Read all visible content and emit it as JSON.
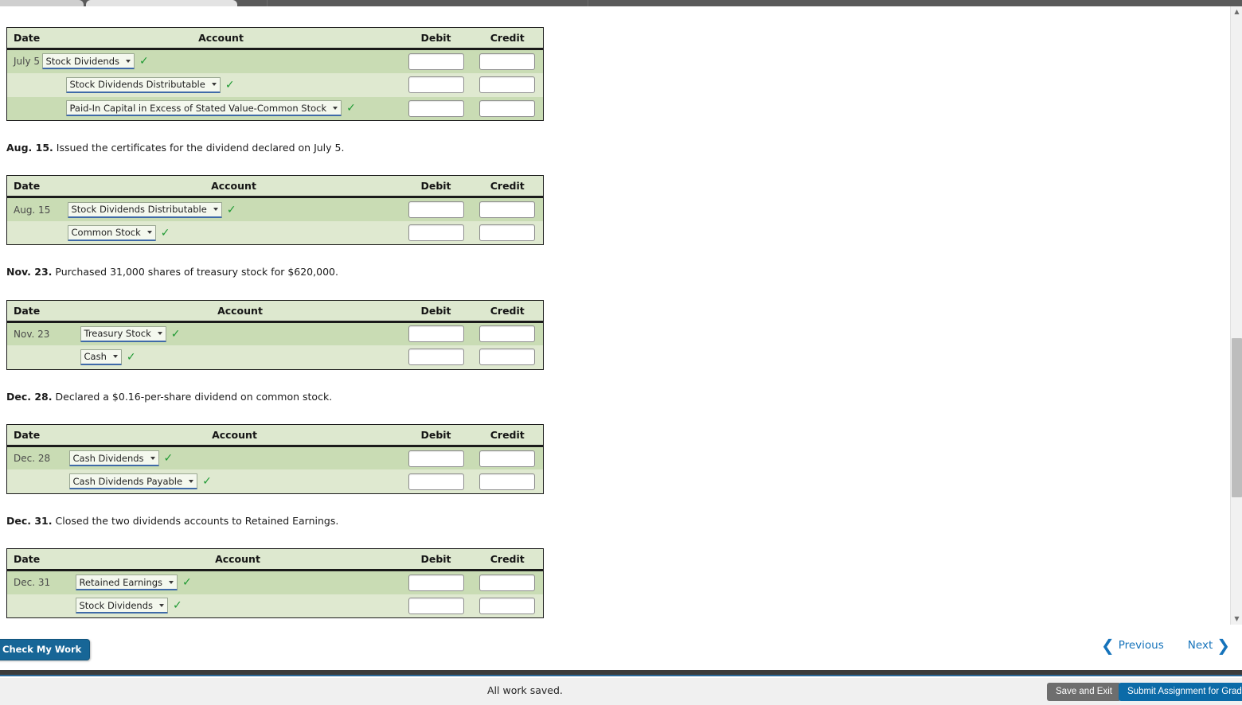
{
  "accent": {
    "blue": "#1573bb",
    "button_blue": "#176697",
    "submit_blue": "#0b6ba8",
    "check_green": "#1f9a33",
    "row_dark": "#c9dcb4",
    "row_light": "#dfe9d0",
    "header_green": "#dde8cf"
  },
  "columns": {
    "date": "Date",
    "account": "Account",
    "debit": "Debit",
    "credit": "Credit"
  },
  "icons": {
    "caret": "chevron-down-icon",
    "check": "check-mark-icon",
    "prev_chevron": "chevron-left-icon",
    "next_chevron": "chevron-right-icon",
    "scroll_up": "scroll-up-arrow-icon",
    "scroll_down": "scroll-down-arrow-icon"
  },
  "entries": [
    {
      "narrative_date": "",
      "narrative_text": "",
      "show_narrative": false,
      "widths": {
        "date": 44,
        "account": 450,
        "debit": 90,
        "credit": 90
      },
      "rows": [
        {
          "date": "July 5",
          "account": "Stock Dividends",
          "indent": false,
          "check": "✓",
          "debit": "",
          "credit": ""
        },
        {
          "date": "",
          "account": "Stock Dividends Distributable",
          "indent": true,
          "check": "✓",
          "debit": "",
          "credit": ""
        },
        {
          "date": "",
          "account": "Paid-In Capital in Excess of Stated Value-Common Stock",
          "indent": true,
          "check": "✓",
          "debit": "",
          "credit": ""
        }
      ]
    },
    {
      "narrative_date": "Aug. 15.",
      "narrative_text": "Issued the certificates for the dividend declared on July 5.",
      "show_narrative": true,
      "widths": {
        "date": 76,
        "account": 418,
        "debit": 90,
        "credit": 90
      },
      "rows": [
        {
          "date": "Aug. 15",
          "account": "Stock Dividends Distributable",
          "indent": false,
          "check": "✓",
          "debit": "",
          "credit": ""
        },
        {
          "date": "",
          "account": "Common Stock",
          "indent": false,
          "check": "✓",
          "debit": "",
          "credit": ""
        }
      ]
    },
    {
      "narrative_date": "Nov. 23.",
      "narrative_text": "Purchased 31,000 shares of treasury stock for $620,000.",
      "show_narrative": true,
      "widths": {
        "date": 92,
        "account": 402,
        "debit": 90,
        "credit": 90
      },
      "rows": [
        {
          "date": "Nov. 23",
          "account": "Treasury Stock",
          "indent": false,
          "check": "✓",
          "debit": "",
          "credit": ""
        },
        {
          "date": "",
          "account": "Cash",
          "indent": false,
          "check": "✓",
          "debit": "",
          "credit": ""
        }
      ]
    },
    {
      "narrative_date": "Dec. 28.",
      "narrative_text": "Declared a $0.16-per-share dividend on common stock.",
      "show_narrative": true,
      "widths": {
        "date": 78,
        "account": 416,
        "debit": 90,
        "credit": 90
      },
      "rows": [
        {
          "date": "Dec. 28",
          "account": "Cash Dividends",
          "indent": false,
          "check": "✓",
          "debit": "",
          "credit": ""
        },
        {
          "date": "",
          "account": "Cash Dividends Payable",
          "indent": false,
          "check": "✓",
          "debit": "",
          "credit": ""
        }
      ]
    },
    {
      "narrative_date": "Dec. 31.",
      "narrative_text": "Closed the two dividends accounts to Retained Earnings.",
      "show_narrative": true,
      "widths": {
        "date": 86,
        "account": 408,
        "debit": 90,
        "credit": 90
      },
      "rows": [
        {
          "date": "Dec. 31",
          "account": "Retained Earnings",
          "indent": false,
          "check": "✓",
          "debit": "",
          "credit": ""
        },
        {
          "date": "",
          "account": "Stock Dividends",
          "indent": false,
          "check": "✓",
          "debit": "",
          "credit": ""
        }
      ]
    }
  ],
  "footer": {
    "check_my_work": "Check My Work",
    "previous": "Previous",
    "next": "Next",
    "prev_chevron": "❮",
    "next_chevron": "❯"
  },
  "statusbar": {
    "saved_text": "All work saved.",
    "save_and_exit": "Save and Exit",
    "submit": "Submit Assignment for Grading"
  },
  "scrollbar": {
    "up_glyph": "▲",
    "down_glyph": "▼"
  }
}
